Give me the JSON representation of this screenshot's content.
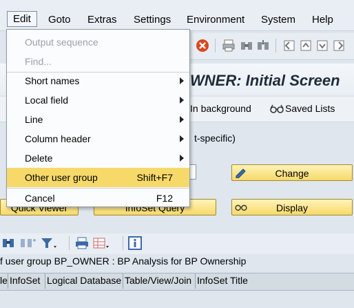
{
  "menubar": {
    "items": [
      {
        "label": "Edit"
      },
      {
        "label": "Goto"
      },
      {
        "label": "Extras"
      },
      {
        "label": "Settings"
      },
      {
        "label": "Environment"
      },
      {
        "label": "System"
      },
      {
        "label": "Help"
      }
    ]
  },
  "title": "WNER: Initial Screen",
  "app_toolbar": {
    "background_label": "In background",
    "saved_lists_label": "Saved Lists"
  },
  "mid_text": "t-specific)",
  "buttons": {
    "change": "Change",
    "display": "Display",
    "quick_viewer": "Quick Viewer",
    "infoset_query": "InfoSet Query"
  },
  "list_header": "f user group BP_OWNER : BP Analysis for BP Ownership",
  "table": {
    "columns": [
      "le",
      "InfoSet",
      "Logical Database",
      "Table/View/Join",
      "InfoSet Title"
    ]
  },
  "edit_menu": {
    "items": [
      {
        "label": "Output sequence",
        "shortcut": "",
        "disabled": true,
        "submenu": false
      },
      {
        "label": "Find...",
        "shortcut": "",
        "disabled": true,
        "submenu": false
      },
      {
        "label": "Short names",
        "shortcut": "",
        "disabled": false,
        "submenu": true
      },
      {
        "label": "Local field",
        "shortcut": "",
        "disabled": false,
        "submenu": true
      },
      {
        "label": "Line",
        "shortcut": "",
        "disabled": false,
        "submenu": true
      },
      {
        "label": "Column header",
        "shortcut": "",
        "disabled": false,
        "submenu": true
      },
      {
        "label": "Delete",
        "shortcut": "",
        "disabled": false,
        "submenu": true
      },
      {
        "label": "Other user group",
        "shortcut": "Shift+F7",
        "disabled": false,
        "submenu": false,
        "highlighted": true
      },
      {
        "label": "Cancel",
        "shortcut": "F12",
        "disabled": false,
        "submenu": false
      }
    ]
  },
  "colors": {
    "highlight": "#f7d96a",
    "button_yellow": "#f7d96a",
    "title_text": "#1f2b3a"
  }
}
